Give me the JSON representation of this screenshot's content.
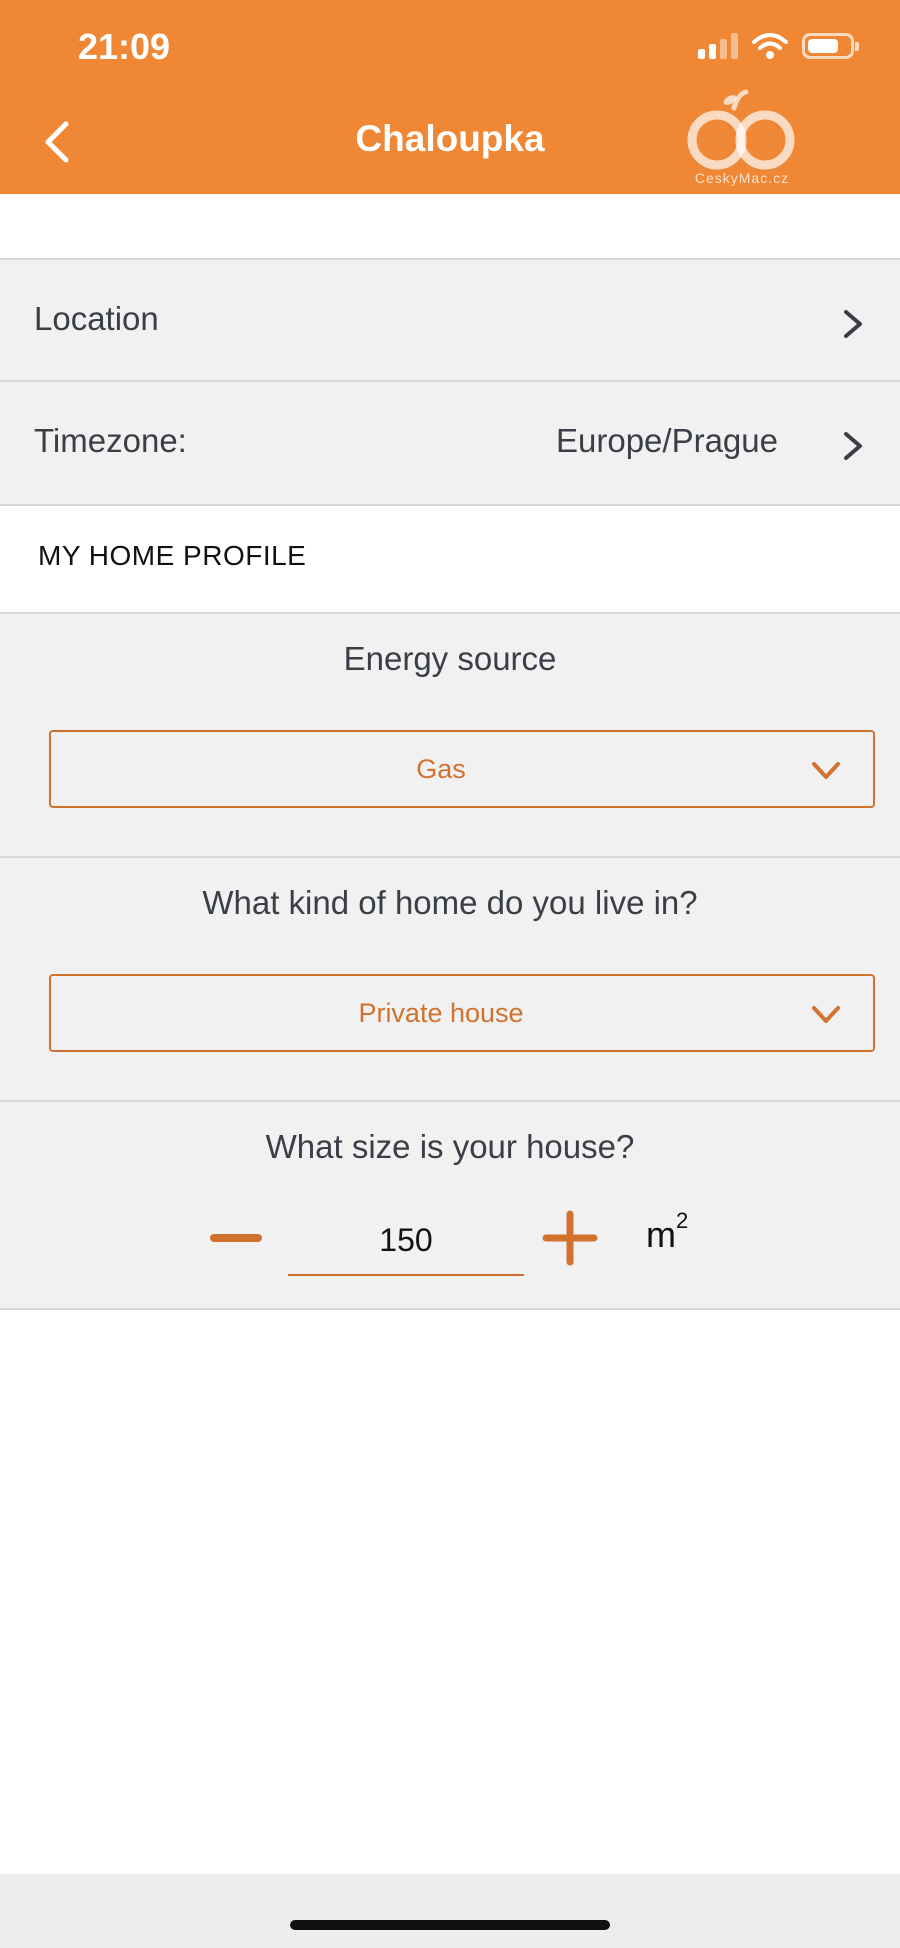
{
  "status_bar": {
    "time": "21:09"
  },
  "header": {
    "title": "Chaloupka",
    "logo_text": "CeskyMac.cz",
    "accent_color": "#ef8735"
  },
  "settings": {
    "location_label": "Location",
    "timezone_label": "Timezone:",
    "timezone_value": "Europe/Prague"
  },
  "profile": {
    "section_title": "MY HOME PROFILE",
    "energy_question": "Energy source",
    "energy_value": "Gas",
    "home_question": "What kind of home do you live in?",
    "home_value": "Private house",
    "size_question": "What size is your house?",
    "size_value": "150",
    "size_unit": "m",
    "size_unit_exp": "2"
  },
  "icons": [
    "back-chevron-icon",
    "signal-icon",
    "wifi-icon",
    "battery-icon",
    "chevron-right-icon",
    "chevron-down-icon",
    "minus-icon",
    "plus-icon"
  ],
  "colors": {
    "orange": "#ef8735",
    "accent_dark": "#d2722f",
    "row_bg": "#f1f1f1"
  }
}
